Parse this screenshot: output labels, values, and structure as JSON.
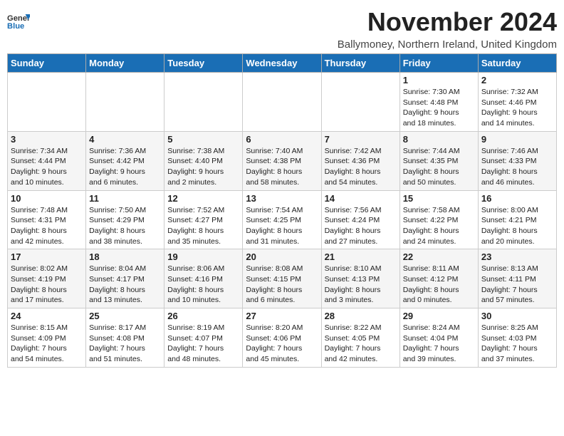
{
  "header": {
    "logo_line1": "General",
    "logo_line2": "Blue",
    "month_title": "November 2024",
    "subtitle": "Ballymoney, Northern Ireland, United Kingdom"
  },
  "weekdays": [
    "Sunday",
    "Monday",
    "Tuesday",
    "Wednesday",
    "Thursday",
    "Friday",
    "Saturday"
  ],
  "weeks": [
    [
      {
        "day": "",
        "info": ""
      },
      {
        "day": "",
        "info": ""
      },
      {
        "day": "",
        "info": ""
      },
      {
        "day": "",
        "info": ""
      },
      {
        "day": "",
        "info": ""
      },
      {
        "day": "1",
        "info": "Sunrise: 7:30 AM\nSunset: 4:48 PM\nDaylight: 9 hours\nand 18 minutes."
      },
      {
        "day": "2",
        "info": "Sunrise: 7:32 AM\nSunset: 4:46 PM\nDaylight: 9 hours\nand 14 minutes."
      }
    ],
    [
      {
        "day": "3",
        "info": "Sunrise: 7:34 AM\nSunset: 4:44 PM\nDaylight: 9 hours\nand 10 minutes."
      },
      {
        "day": "4",
        "info": "Sunrise: 7:36 AM\nSunset: 4:42 PM\nDaylight: 9 hours\nand 6 minutes."
      },
      {
        "day": "5",
        "info": "Sunrise: 7:38 AM\nSunset: 4:40 PM\nDaylight: 9 hours\nand 2 minutes."
      },
      {
        "day": "6",
        "info": "Sunrise: 7:40 AM\nSunset: 4:38 PM\nDaylight: 8 hours\nand 58 minutes."
      },
      {
        "day": "7",
        "info": "Sunrise: 7:42 AM\nSunset: 4:36 PM\nDaylight: 8 hours\nand 54 minutes."
      },
      {
        "day": "8",
        "info": "Sunrise: 7:44 AM\nSunset: 4:35 PM\nDaylight: 8 hours\nand 50 minutes."
      },
      {
        "day": "9",
        "info": "Sunrise: 7:46 AM\nSunset: 4:33 PM\nDaylight: 8 hours\nand 46 minutes."
      }
    ],
    [
      {
        "day": "10",
        "info": "Sunrise: 7:48 AM\nSunset: 4:31 PM\nDaylight: 8 hours\nand 42 minutes."
      },
      {
        "day": "11",
        "info": "Sunrise: 7:50 AM\nSunset: 4:29 PM\nDaylight: 8 hours\nand 38 minutes."
      },
      {
        "day": "12",
        "info": "Sunrise: 7:52 AM\nSunset: 4:27 PM\nDaylight: 8 hours\nand 35 minutes."
      },
      {
        "day": "13",
        "info": "Sunrise: 7:54 AM\nSunset: 4:25 PM\nDaylight: 8 hours\nand 31 minutes."
      },
      {
        "day": "14",
        "info": "Sunrise: 7:56 AM\nSunset: 4:24 PM\nDaylight: 8 hours\nand 27 minutes."
      },
      {
        "day": "15",
        "info": "Sunrise: 7:58 AM\nSunset: 4:22 PM\nDaylight: 8 hours\nand 24 minutes."
      },
      {
        "day": "16",
        "info": "Sunrise: 8:00 AM\nSunset: 4:21 PM\nDaylight: 8 hours\nand 20 minutes."
      }
    ],
    [
      {
        "day": "17",
        "info": "Sunrise: 8:02 AM\nSunset: 4:19 PM\nDaylight: 8 hours\nand 17 minutes."
      },
      {
        "day": "18",
        "info": "Sunrise: 8:04 AM\nSunset: 4:17 PM\nDaylight: 8 hours\nand 13 minutes."
      },
      {
        "day": "19",
        "info": "Sunrise: 8:06 AM\nSunset: 4:16 PM\nDaylight: 8 hours\nand 10 minutes."
      },
      {
        "day": "20",
        "info": "Sunrise: 8:08 AM\nSunset: 4:15 PM\nDaylight: 8 hours\nand 6 minutes."
      },
      {
        "day": "21",
        "info": "Sunrise: 8:10 AM\nSunset: 4:13 PM\nDaylight: 8 hours\nand 3 minutes."
      },
      {
        "day": "22",
        "info": "Sunrise: 8:11 AM\nSunset: 4:12 PM\nDaylight: 8 hours\nand 0 minutes."
      },
      {
        "day": "23",
        "info": "Sunrise: 8:13 AM\nSunset: 4:11 PM\nDaylight: 7 hours\nand 57 minutes."
      }
    ],
    [
      {
        "day": "24",
        "info": "Sunrise: 8:15 AM\nSunset: 4:09 PM\nDaylight: 7 hours\nand 54 minutes."
      },
      {
        "day": "25",
        "info": "Sunrise: 8:17 AM\nSunset: 4:08 PM\nDaylight: 7 hours\nand 51 minutes."
      },
      {
        "day": "26",
        "info": "Sunrise: 8:19 AM\nSunset: 4:07 PM\nDaylight: 7 hours\nand 48 minutes."
      },
      {
        "day": "27",
        "info": "Sunrise: 8:20 AM\nSunset: 4:06 PM\nDaylight: 7 hours\nand 45 minutes."
      },
      {
        "day": "28",
        "info": "Sunrise: 8:22 AM\nSunset: 4:05 PM\nDaylight: 7 hours\nand 42 minutes."
      },
      {
        "day": "29",
        "info": "Sunrise: 8:24 AM\nSunset: 4:04 PM\nDaylight: 7 hours\nand 39 minutes."
      },
      {
        "day": "30",
        "info": "Sunrise: 8:25 AM\nSunset: 4:03 PM\nDaylight: 7 hours\nand 37 minutes."
      }
    ]
  ]
}
